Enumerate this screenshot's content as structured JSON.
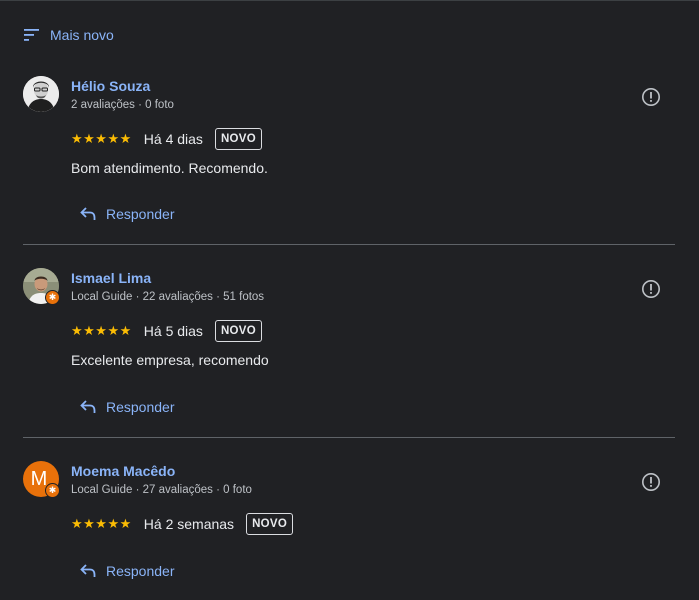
{
  "sort": {
    "label": "Mais novo"
  },
  "reviews": [
    {
      "name": "Hélio Souza",
      "meta": "2 avaliações · 0 foto",
      "stars": "★★★★★",
      "rating": 5,
      "date": "Há 4 dias",
      "badge": "NOVO",
      "text": "Bom atendimento. Recomendo.",
      "reply_label": "Responder"
    },
    {
      "name": "Ismael Lima",
      "meta": "Local Guide · 22 avaliações · 51 fotos",
      "stars": "★★★★★",
      "rating": 5,
      "date": "Há 5 dias",
      "badge": "NOVO",
      "text": "Excelente empresa, recomendo",
      "reply_label": "Responder"
    },
    {
      "name": "Moema Macêdo",
      "meta": "Local Guide · 27 avaliações · 0 foto",
      "avatar_letter": "M",
      "stars": "★★★★★",
      "rating": 5,
      "date": "Há 2 semanas",
      "badge": "NOVO",
      "text": "",
      "reply_label": "Responder"
    }
  ],
  "colors": {
    "background": "#202124",
    "link": "#8ab4f8",
    "star": "#fbbc04",
    "local_guide_badge": "#e8710a",
    "avatar_orange": "#e8710a"
  },
  "icons": {
    "sort": "sort-lines-icon",
    "flag": "report-exclamation-icon",
    "reply": "reply-arrow-icon",
    "local_guide": "local-guide-star-icon"
  }
}
